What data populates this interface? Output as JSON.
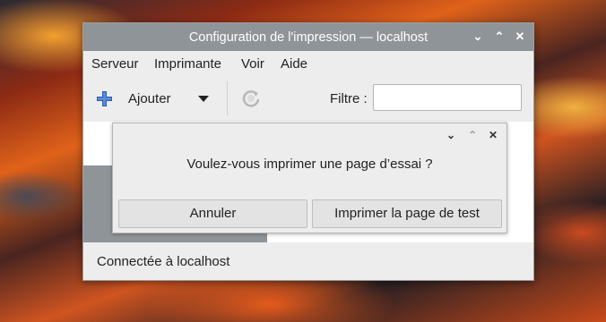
{
  "window": {
    "title": "Configuration de l'impression — localhost",
    "controls": [
      "chevron-down-icon",
      "chevron-up-icon",
      "close-icon"
    ]
  },
  "menubar": {
    "items": [
      "Serveur",
      "Imprimante",
      "Voir",
      "Aide"
    ]
  },
  "toolbar": {
    "add_label": "Ajouter",
    "filter_label": "Filtre :",
    "filter_value": ""
  },
  "statusbar": {
    "text": "Connectée à localhost"
  },
  "dialog": {
    "message": "Voulez-vous imprimer une page d’essai ?",
    "cancel_label": "Annuler",
    "confirm_label": "Imprimer la page de test"
  },
  "colors": {
    "titlebar": "#8f9499",
    "window_bg": "#ededed",
    "add_icon": "#2a5db0"
  }
}
